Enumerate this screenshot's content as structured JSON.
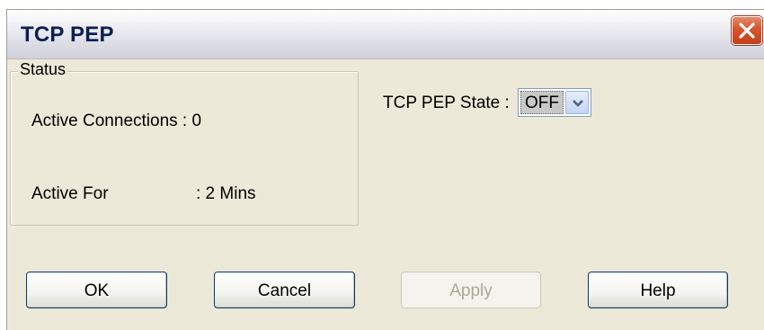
{
  "window": {
    "title": "TCP PEP",
    "close_icon": "close-icon"
  },
  "status": {
    "legend": "Status",
    "active_connections_label": "Active Connections : 0",
    "active_for_label": "Active For",
    "active_for_value": ": 2 Mins"
  },
  "state": {
    "label": "TCP PEP State :",
    "value": "OFF",
    "arrow_icon": "chevron-down-icon"
  },
  "buttons": {
    "ok": "OK",
    "cancel": "Cancel",
    "apply": "Apply",
    "help": "Help"
  },
  "colors": {
    "window_bg": "#ece9d8",
    "title_text": "#0a1e55",
    "close_button": "#d7542e",
    "button_border": "#003c74",
    "disabled_text": "#aca899"
  }
}
